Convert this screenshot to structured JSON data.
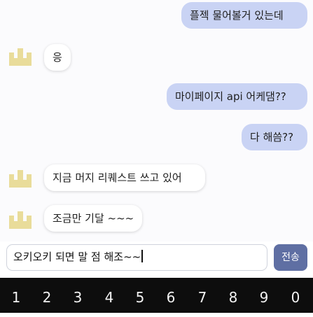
{
  "colors": {
    "sent_bubble": "#c9d3f4",
    "received_bubble": "#ffffff",
    "send_button": "#5f6fa3",
    "avatar": "#e9dc9a",
    "keyboard": "#0d0d0d"
  },
  "messages": [
    {
      "side": "me",
      "text": "플젝 물어볼거 있는데"
    },
    {
      "side": "other",
      "text": "응",
      "avatar_icon": "crown-icon"
    },
    {
      "side": "me",
      "text": "마이페이지 api 어케댐??"
    },
    {
      "side": "me",
      "text": "다 해씀??"
    },
    {
      "side": "other",
      "text": "지금 머지 리퀘스트 쓰고 있어",
      "avatar_icon": "crown-icon"
    },
    {
      "side": "other",
      "text": "조금만 기달 ~~~",
      "avatar_icon": "crown-icon"
    }
  ],
  "composer": {
    "value": "오키오키 되면 말 점 해조~~",
    "send_label": "전송"
  },
  "keyboard": {
    "keys": [
      "1",
      "2",
      "3",
      "4",
      "5",
      "6",
      "7",
      "8",
      "9",
      "0"
    ]
  }
}
